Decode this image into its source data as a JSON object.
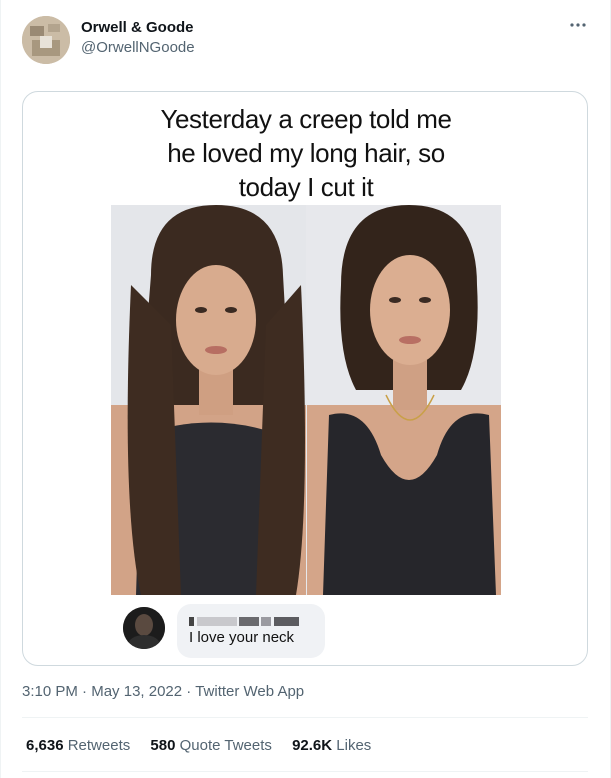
{
  "author": {
    "name": "Orwell & Goode",
    "handle": "@OrwellNGoode"
  },
  "menu_icon": "more-horizontal-icon",
  "media": {
    "caption_lines": [
      "Yesterday a creep told me",
      "he loved my long hair, so",
      "today I cut it"
    ],
    "comment": {
      "name_redacted": "",
      "text": "I love your neck"
    }
  },
  "meta": {
    "time": "3:10 PM",
    "sep1": " · ",
    "date": "May 13, 2022",
    "sep2": " · ",
    "source": "Twitter Web App"
  },
  "stats": {
    "retweets": {
      "count": "6,636",
      "label": "Retweets"
    },
    "quotes": {
      "count": "580",
      "label": "Quote Tweets"
    },
    "likes": {
      "count": "92.6K",
      "label": "Likes"
    }
  },
  "colors": {
    "text_primary": "#0f1419",
    "text_secondary": "#536471",
    "border": "#cfd9de",
    "divider": "#eff3f4"
  }
}
